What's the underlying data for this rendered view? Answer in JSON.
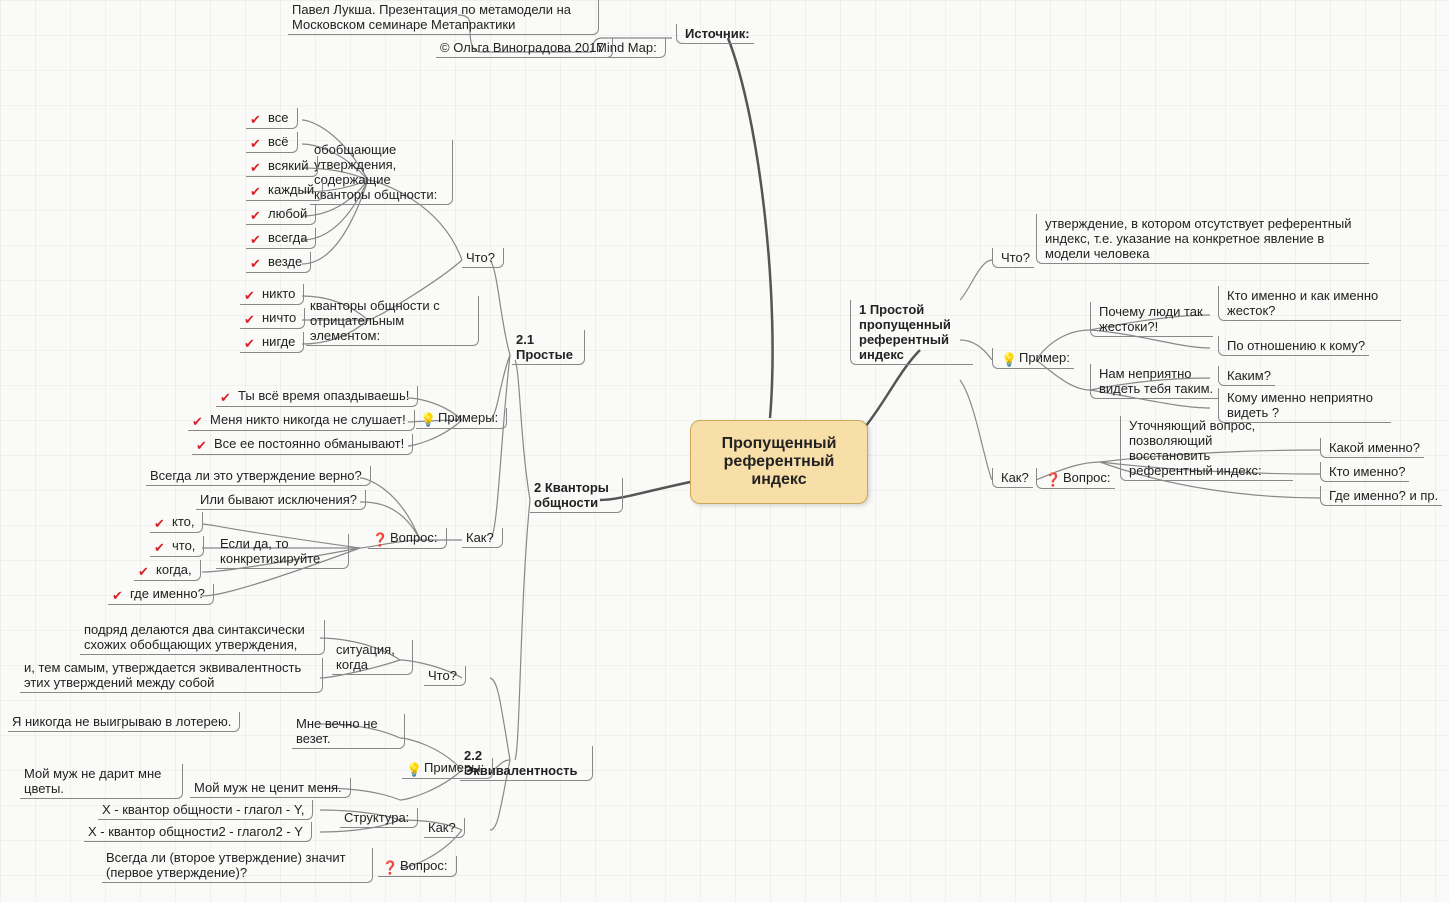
{
  "root": "Пропущенный референтный индекс",
  "source": {
    "label": "Источник:",
    "mind": "Mind Map:",
    "copy": "© Ольга Виноградова 2017",
    "pres": "Павел Лукша. Презентация по метамодели на Московском семинаре Метапрактики"
  },
  "r1": {
    "title": "1 Простой пропущенный референтный индекс",
    "what": "Что?",
    "what_t": "утверждение, в котором отсутствует референтный индекс, т.е. указание на конкретное явление в модели человека",
    "ex": "Пример:",
    "ex1_l": "Почему люди так жестоки?!",
    "ex1_a": "Кто именно и как именно жесток?",
    "ex1_b": "По отношению к кому?",
    "ex2_l": "Нам неприятно видеть тебя таким.",
    "ex2_a": "Каким?",
    "ex2_b": "Кому именно неприятно видеть ?",
    "how": "Как?",
    "q": "Вопрос:",
    "q_t": "Уточняющий вопрос, позволяющий восстановить референтный индекс:",
    "qa": "Какой именно?",
    "qb": "Кто именно?",
    "qc": "Где именно? и пр."
  },
  "l2": {
    "title": "2 Кванторы общности"
  },
  "l21": {
    "title": "2.1 Простые",
    "what": "Что?",
    "gen": "обобщающие утверждения, содержащие кванторы общности:",
    "g": [
      "все",
      "всё",
      "всякий",
      "каждый",
      "любой",
      "всегда",
      "везде"
    ],
    "neg": "кванторы общности с отрицательным элементом:",
    "n": [
      "никто",
      "ничто",
      "нигде"
    ],
    "ex": "Примеры:",
    "e": [
      "Ты всё время опаздываешь!",
      "Меня никто никогда не слушает!",
      "Все ее постоянно обманывают!"
    ],
    "how": "Как?",
    "q": "Вопрос:",
    "qa": "Всегда ли это утверждение верно?",
    "qb": "Или бывают исключения?",
    "qc": "Если да, то конкретизируйте",
    "qci": [
      "кто,",
      "что,",
      "когда,",
      "где именно?"
    ]
  },
  "l22": {
    "title": "2.2 Эквивалентность",
    "what": "Что?",
    "sit": "ситуация, когда",
    "sit_a": "подряд делаются два синтаксически схожих обобщающих утверждения,",
    "sit_b": "и, тем самым, утверждается эквивалентность этих утверждений между собой",
    "ex": "Примеры:",
    "e1_l": "Мне вечно не везет.",
    "e1_r": "Я никогда не выигрываю в лотерею.",
    "e2_l": "Мой муж не ценит меня.",
    "e2_r": "Мой муж не дарит мне цветы.",
    "how": "Как?",
    "st": "Структура:",
    "st_a": "X - квантор общности - глагол - Y,",
    "st_b": "X - квантор общности2 - глагол2 - Y",
    "q": "Вопрос:",
    "qt": "Всегда ли (второе утверждение) значит (первое утверждение)?"
  }
}
